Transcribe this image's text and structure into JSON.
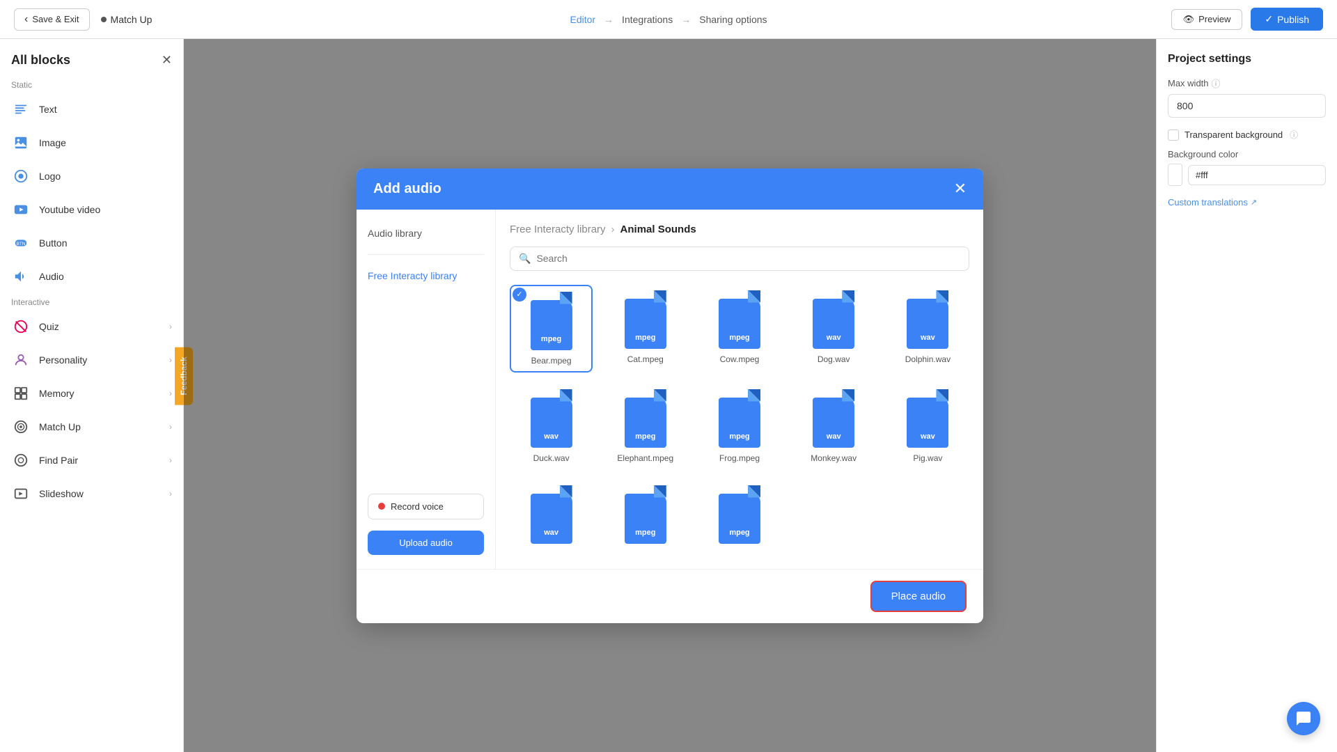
{
  "topbar": {
    "save_exit_label": "Save & Exit",
    "current_page": "Match Up",
    "nav_editor": "Editor",
    "nav_integrations": "Integrations",
    "nav_sharing": "Sharing options",
    "preview_label": "Preview",
    "publish_label": "Publish"
  },
  "sidebar": {
    "title": "All blocks",
    "section_static": "Static",
    "items_static": [
      {
        "id": "text",
        "label": "Text",
        "icon": "text-icon"
      },
      {
        "id": "image",
        "label": "Image",
        "icon": "image-icon"
      },
      {
        "id": "logo",
        "label": "Logo",
        "icon": "logo-icon"
      },
      {
        "id": "youtube",
        "label": "Youtube video",
        "icon": "youtube-icon"
      },
      {
        "id": "button",
        "label": "Button",
        "icon": "button-icon"
      },
      {
        "id": "audio",
        "label": "Audio",
        "icon": "audio-icon"
      }
    ],
    "section_interactive": "Interactive",
    "items_interactive": [
      {
        "id": "quiz",
        "label": "Quiz",
        "has_arrow": true
      },
      {
        "id": "personality",
        "label": "Personality",
        "has_arrow": true
      },
      {
        "id": "memory",
        "label": "Memory",
        "has_arrow": true
      },
      {
        "id": "matchup",
        "label": "Match Up",
        "has_arrow": true
      },
      {
        "id": "findpair",
        "label": "Find Pair",
        "has_arrow": true
      },
      {
        "id": "slideshow",
        "label": "Slideshow",
        "has_arrow": true
      }
    ]
  },
  "right_panel": {
    "title": "Project settings",
    "max_width_label": "Max width",
    "max_width_value": "800",
    "transparent_bg_label": "Transparent background",
    "bg_color_label": "Background color",
    "bg_color_value": "#fff",
    "custom_translations_label": "Custom translations"
  },
  "modal": {
    "title": "Add audio",
    "nav_audio_library": "Audio library",
    "nav_free_library": "Free Interacty library",
    "record_voice_label": "Record voice",
    "upload_audio_label": "Upload audio",
    "breadcrumb_parent": "Free Interacty library",
    "breadcrumb_current": "Animal Sounds",
    "search_placeholder": "Search",
    "files": [
      {
        "id": "bear",
        "name": "Bear.mpeg",
        "type": "mpeg",
        "selected": true
      },
      {
        "id": "cat",
        "name": "Cat.mpeg",
        "type": "mpeg",
        "selected": false
      },
      {
        "id": "cow",
        "name": "Cow.mpeg",
        "type": "mpeg",
        "selected": false
      },
      {
        "id": "dog",
        "name": "Dog.wav",
        "type": "wav",
        "selected": false
      },
      {
        "id": "dolphin",
        "name": "Dolphin.wav",
        "type": "wav",
        "selected": false
      },
      {
        "id": "duck",
        "name": "Duck.wav",
        "type": "wav",
        "selected": false
      },
      {
        "id": "elephant",
        "name": "Elephant.mpeg",
        "type": "mpeg",
        "selected": false
      },
      {
        "id": "frog",
        "name": "Frog.mpeg",
        "type": "mpeg",
        "selected": false
      },
      {
        "id": "monkey",
        "name": "Monkey.wav",
        "type": "wav",
        "selected": false
      },
      {
        "id": "pig",
        "name": "Pig.wav",
        "type": "wav",
        "selected": false
      },
      {
        "id": "row3a",
        "name": "",
        "type": "wav",
        "selected": false
      },
      {
        "id": "row3b",
        "name": "",
        "type": "mpeg",
        "selected": false
      },
      {
        "id": "row3c",
        "name": "",
        "type": "mpeg",
        "selected": false
      }
    ],
    "place_audio_label": "Place audio"
  },
  "feedback_tab": "Feedback"
}
